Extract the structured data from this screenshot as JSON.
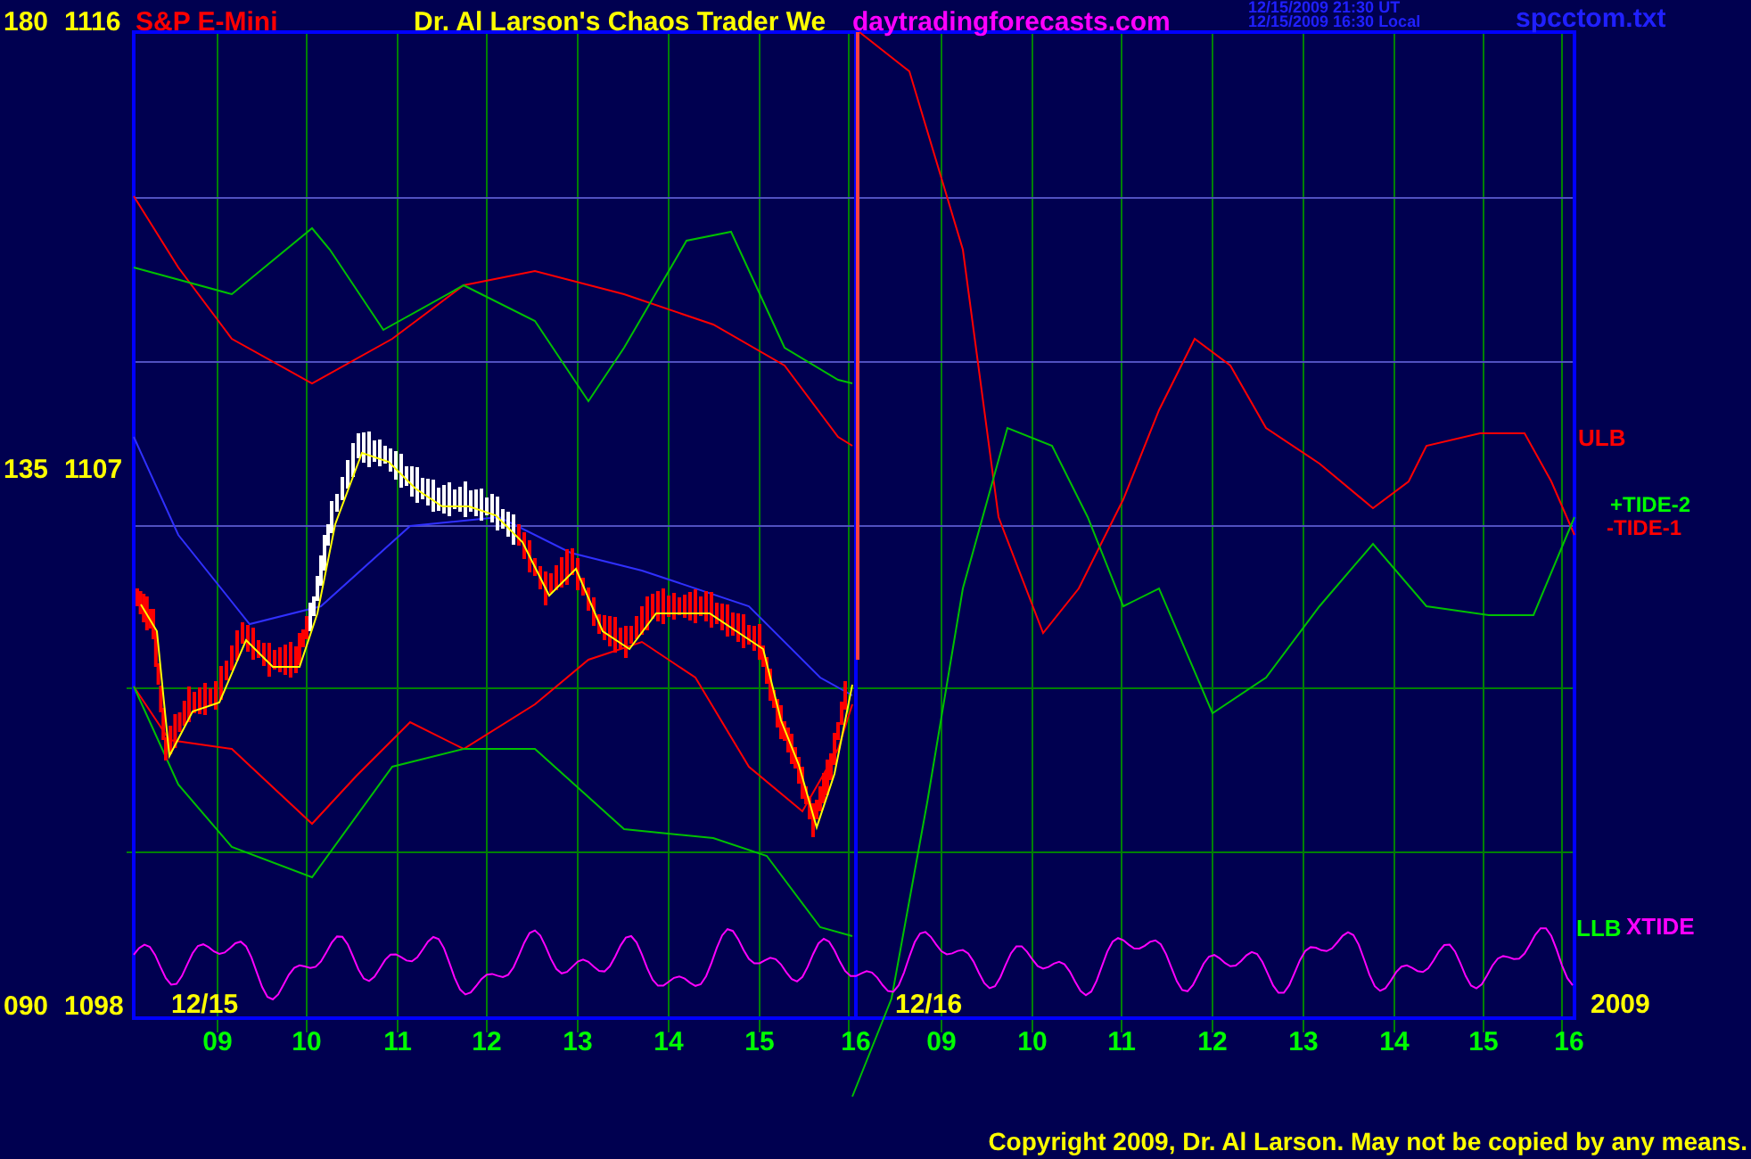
{
  "header": {
    "symbol": "S&P E-Mini",
    "title": "Dr. Al Larson's Chaos Trader We",
    "site": "daytradingforecasts.com",
    "time_ut": "12/15/2009 21:30 UT",
    "time_local": "12/15/2009 16:30 Local",
    "file": "spcctom.txt"
  },
  "y_axis_labels": [
    {
      "cycle": "180",
      "price": "1116"
    },
    {
      "cycle": "135",
      "price": "1107"
    },
    {
      "cycle": "090",
      "price": "1098"
    }
  ],
  "date_labels": [
    "12/15",
    "12/16",
    "2009"
  ],
  "hour_labels": [
    "09",
    "10",
    "11",
    "12",
    "13",
    "14",
    "15",
    "16",
    "09",
    "10",
    "11",
    "12",
    "13",
    "14",
    "15",
    "16"
  ],
  "line_labels": [
    {
      "text": "ULB",
      "color": "#ff0000"
    },
    {
      "text": "+TIDE-2",
      "color": "#00ff00"
    },
    {
      "text": "-TIDE-1",
      "color": "#ff0000"
    },
    {
      "text": "LLB",
      "color": "#00ff00"
    },
    {
      "text": "XTIDE",
      "color": "#ff00ff"
    }
  ],
  "copyright": "Copyright 2009, Dr. Al Larson. May not be copied by any means."
}
